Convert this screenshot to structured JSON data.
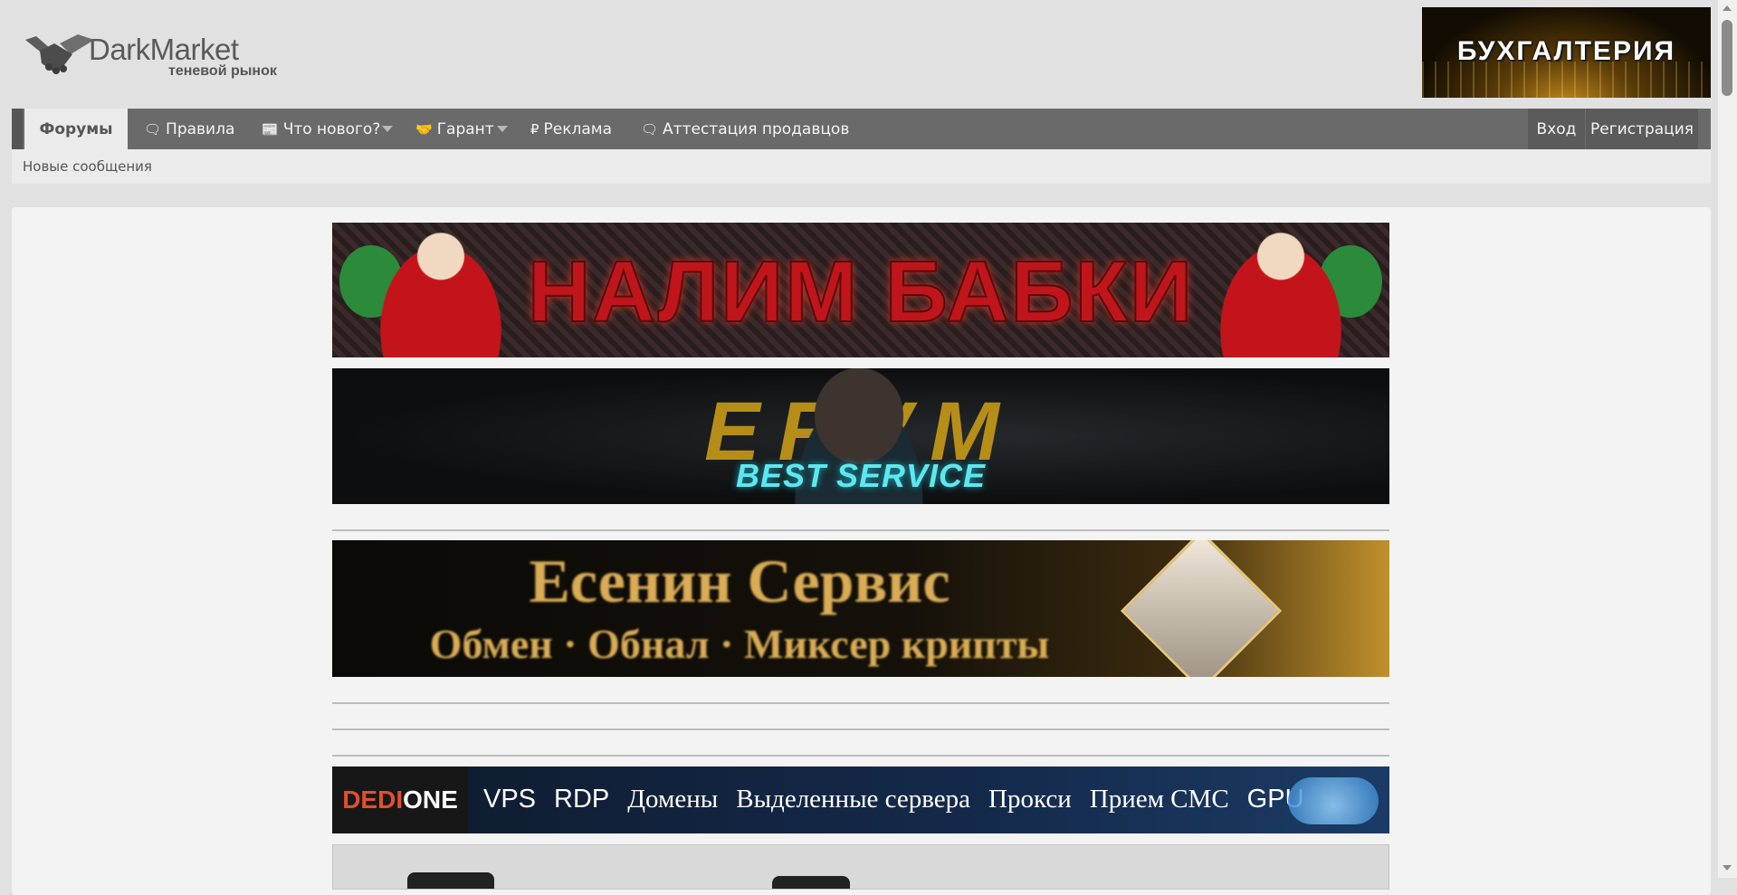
{
  "header": {
    "logo_name": "DarkMarket",
    "logo_tagline": "теневой рынок",
    "top_banner_text": "БУХГАЛТЕРИЯ"
  },
  "nav": {
    "active_tab": "Форумы",
    "items": [
      {
        "label": "Правила",
        "icon": "speech-bubble-icon"
      },
      {
        "label": "Что нового?",
        "icon": "newspaper-icon"
      },
      {
        "label": "Гарант",
        "icon": "handshake-icon"
      },
      {
        "label": "Реклама",
        "icon": "ruble-icon"
      },
      {
        "label": "Аттестация продавцов",
        "icon": "speech-bubble-icon"
      }
    ],
    "login": "Вход",
    "register": "Регистрация"
  },
  "subnav": {
    "new_posts": "Новые сообщения"
  },
  "banners": {
    "b1_text": "НАЛИМ БАБКИ",
    "b2_text": "BEST SERVICE",
    "b3_title": "Есенин Сервис",
    "b3_subtitle": "Обмен · Обнал · Миксер крипты",
    "b4_logo_red": "DEDI",
    "b4_logo_white": "ONE",
    "b4_items": [
      "VPS",
      "RDP",
      "Домены",
      "Выделенные сервера",
      "Прокси",
      "Прием СМС",
      "GPU"
    ]
  },
  "colors": {
    "nav_bg": "#6a6a6a",
    "page_bg": "#e1e1e1",
    "content_bg": "#f3f3f3"
  }
}
